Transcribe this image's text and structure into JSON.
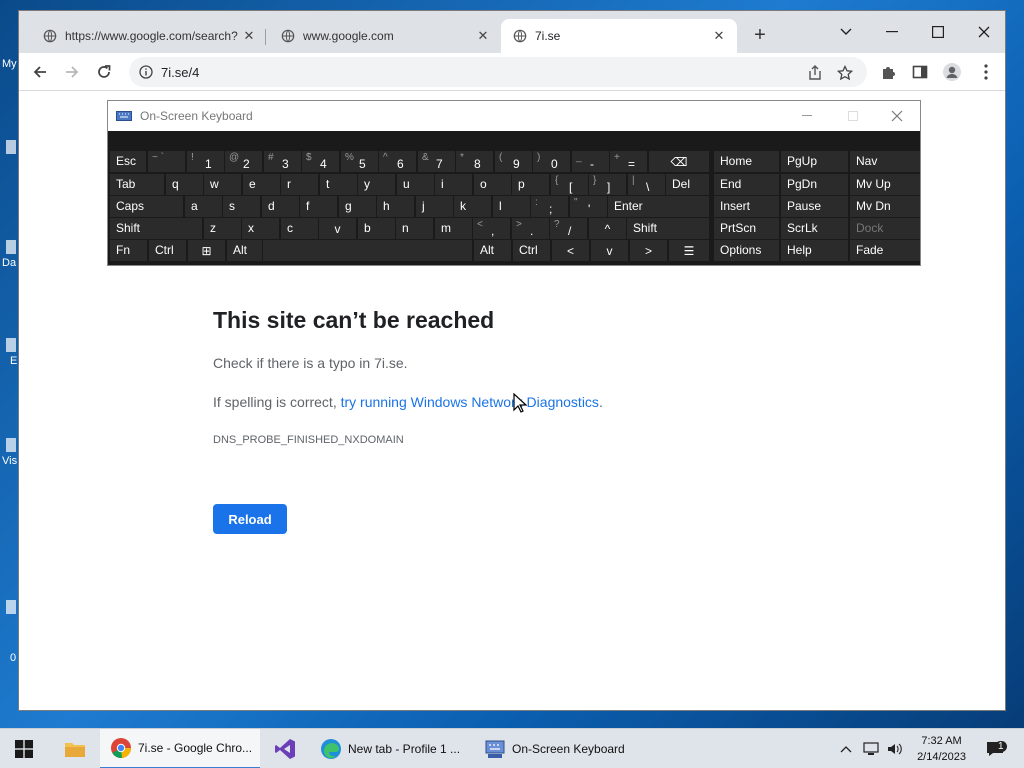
{
  "desktop": {
    "icon_labels": [
      "My",
      "Da",
      "E",
      "Vis",
      "0"
    ]
  },
  "browser": {
    "tabs": [
      {
        "title": "https://www.google.com/search?",
        "active": false
      },
      {
        "title": "www.google.com",
        "active": false
      },
      {
        "title": "7i.se",
        "active": true
      }
    ],
    "close_symbol": "✕",
    "new_tab_symbol": "+",
    "address": "7i.se/4"
  },
  "error_page": {
    "title": "This site can’t be reached",
    "line1": "Check if there is a typo in 7i.se.",
    "line2_prefix": "If spelling is correct, ",
    "line2_link": "try running Windows Network Diagnostics",
    "line2_suffix": ".",
    "code": "DNS_PROBE_FINISHED_NXDOMAIN",
    "reload_label": "Reload"
  },
  "osk": {
    "title": "On-Screen Keyboard",
    "rows": [
      [
        {
          "label": "Esc"
        },
        {
          "sec": "~ `",
          "pri": ""
        },
        {
          "sec": "!",
          "pri": "1"
        },
        {
          "sec": "@",
          "pri": "2"
        },
        {
          "sec": "#",
          "pri": "3"
        },
        {
          "sec": "$",
          "pri": "4"
        },
        {
          "sec": "%",
          "pri": "5"
        },
        {
          "sec": "^",
          "pri": "6"
        },
        {
          "sec": "&",
          "pri": "7"
        },
        {
          "sec": "*",
          "pri": "8"
        },
        {
          "sec": "(",
          "pri": "9"
        },
        {
          "sec": ")",
          "pri": "0"
        },
        {
          "sec": "_",
          "pri": "-"
        },
        {
          "sec": "+",
          "pri": "="
        },
        {
          "label": "⌫"
        }
      ],
      [
        {
          "label": "Tab"
        },
        {
          "label": "q"
        },
        {
          "label": "w"
        },
        {
          "label": "e"
        },
        {
          "label": "r"
        },
        {
          "label": "t"
        },
        {
          "label": "y"
        },
        {
          "label": "u"
        },
        {
          "label": "i"
        },
        {
          "label": "o"
        },
        {
          "label": "p"
        },
        {
          "sec": "{",
          "pri": "["
        },
        {
          "sec": "}",
          "pri": "]"
        },
        {
          "sec": "|",
          "pri": "\\"
        },
        {
          "label": "Del"
        }
      ],
      [
        {
          "label": "Caps"
        },
        {
          "label": "a"
        },
        {
          "label": "s"
        },
        {
          "label": "d"
        },
        {
          "label": "f"
        },
        {
          "label": "g"
        },
        {
          "label": "h"
        },
        {
          "label": "j"
        },
        {
          "label": "k"
        },
        {
          "label": "l"
        },
        {
          "sec": ":",
          "pri": ";"
        },
        {
          "sec": "\"",
          "pri": "'"
        },
        {
          "label": "Enter"
        }
      ],
      [
        {
          "label": "Shift"
        },
        {
          "label": "z"
        },
        {
          "label": "x"
        },
        {
          "label": "c"
        },
        {
          "label": "v"
        },
        {
          "label": "b"
        },
        {
          "label": "n"
        },
        {
          "label": "m"
        },
        {
          "sec": "<",
          "pri": ","
        },
        {
          "sec": ">",
          "pri": "."
        },
        {
          "sec": "?",
          "pri": "/"
        },
        {
          "label": "^"
        },
        {
          "label": "Shift"
        }
      ],
      [
        {
          "label": "Fn"
        },
        {
          "label": "Ctrl"
        },
        {
          "label": "⊞"
        },
        {
          "label": "Alt"
        },
        {
          "label": ""
        },
        {
          "label": "Alt"
        },
        {
          "label": "Ctrl"
        },
        {
          "label": "<"
        },
        {
          "label": "v"
        },
        {
          "label": ">"
        },
        {
          "label": "☰"
        }
      ]
    ],
    "right_cols": [
      [
        "Home",
        "End",
        "Insert",
        "PrtScn",
        "Options"
      ],
      [
        "PgUp",
        "PgDn",
        "Pause",
        "ScrLk",
        "Help"
      ],
      [
        "Nav",
        "Mv Up",
        "Mv Dn",
        "Dock",
        "Fade"
      ]
    ]
  },
  "taskbar": {
    "items": [
      {
        "label": "7i.se - Google Chro...",
        "active": true
      },
      {
        "label": "",
        "active": false
      },
      {
        "label": "New tab - Profile 1 ...",
        "active": false
      },
      {
        "label": "On-Screen Keyboard",
        "active": false
      }
    ],
    "time": "7:32 AM",
    "date": "2/14/2023",
    "notification_count": "1"
  }
}
